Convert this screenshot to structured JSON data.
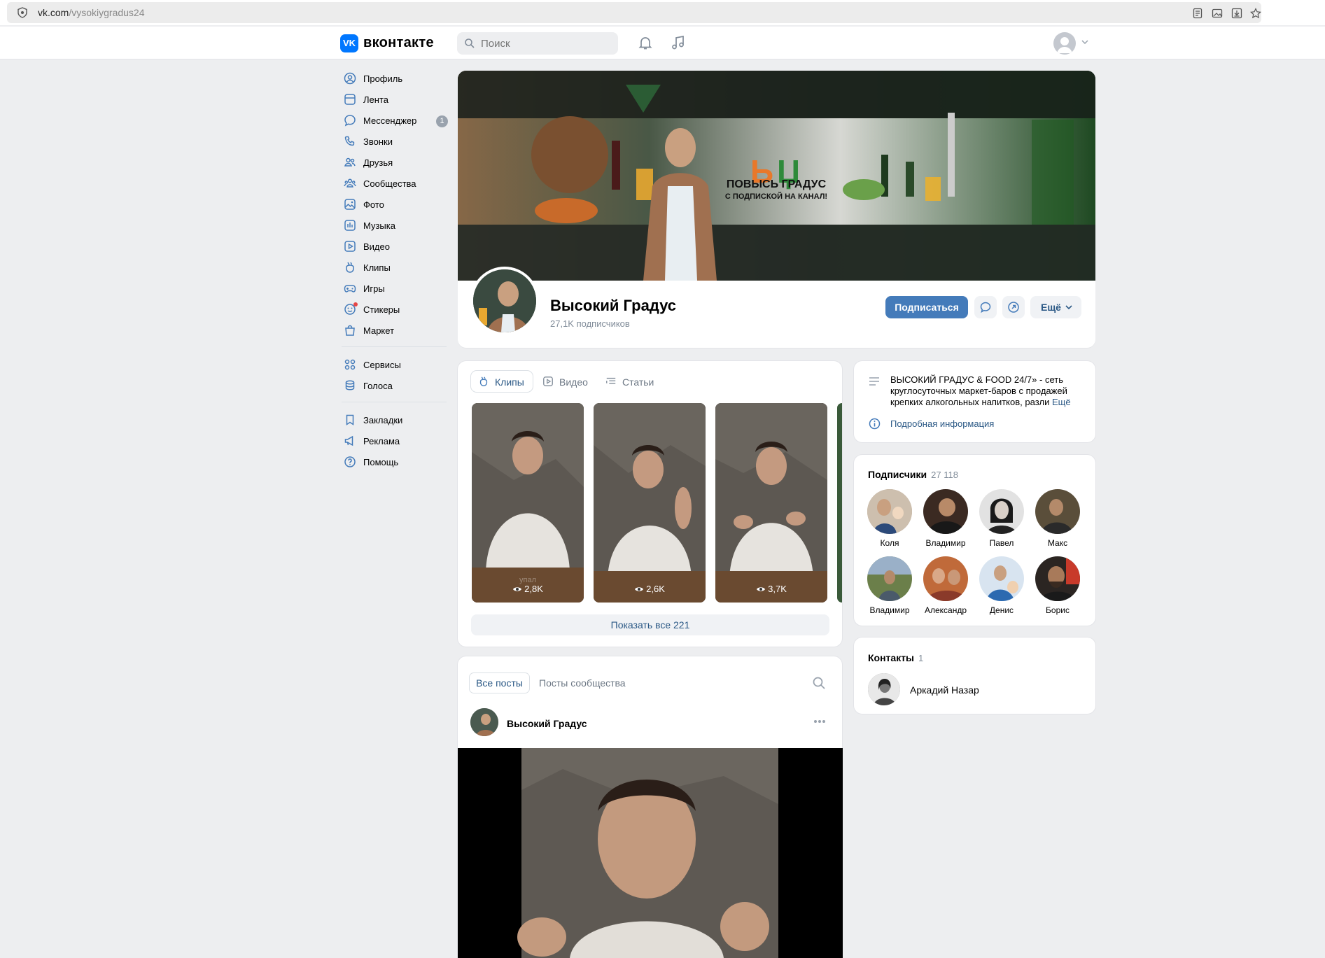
{
  "browser": {
    "url_domain": "vk.com",
    "url_path": "/vysokiygradus24"
  },
  "header": {
    "logo_text": "вконтакте",
    "logo_mark": "VK",
    "search_placeholder": "Поиск"
  },
  "sidebar": {
    "items": [
      {
        "label": "Профиль",
        "icon": "profile-icon"
      },
      {
        "label": "Лента",
        "icon": "feed-icon"
      },
      {
        "label": "Мессенджер",
        "icon": "messenger-icon",
        "badge": "1"
      },
      {
        "label": "Звонки",
        "icon": "phone-icon"
      },
      {
        "label": "Друзья",
        "icon": "friends-icon"
      },
      {
        "label": "Сообщества",
        "icon": "communities-icon"
      },
      {
        "label": "Фото",
        "icon": "photo-icon"
      },
      {
        "label": "Музыка",
        "icon": "music-icon"
      },
      {
        "label": "Видео",
        "icon": "video-icon"
      },
      {
        "label": "Клипы",
        "icon": "clips-icon"
      },
      {
        "label": "Игры",
        "icon": "games-icon"
      },
      {
        "label": "Стикеры",
        "icon": "stickers-icon"
      },
      {
        "label": "Маркет",
        "icon": "market-icon"
      }
    ],
    "items2": [
      {
        "label": "Сервисы",
        "icon": "services-icon"
      },
      {
        "label": "Голоса",
        "icon": "votes-icon"
      }
    ],
    "items3": [
      {
        "label": "Закладки",
        "icon": "bookmark-icon"
      },
      {
        "label": "Реклама",
        "icon": "ads-icon"
      },
      {
        "label": "Помощь",
        "icon": "help-icon"
      }
    ]
  },
  "cover": {
    "banner_line1": "ПОВЫСЬ ГРАДУС",
    "banner_line2": "С ПОДПИСКОЙ НА КАНАЛ!"
  },
  "profile": {
    "name": "Высокий Градус",
    "subscribers": "27,1K подписчиков",
    "subscribe_label": "Подписаться",
    "more_label": "Ещё"
  },
  "media_tabs": [
    {
      "label": "Клипы",
      "active": true
    },
    {
      "label": "Видео",
      "active": false
    },
    {
      "label": "Статьи",
      "active": false
    }
  ],
  "clips": [
    {
      "views": "2,8K"
    },
    {
      "views": "2,6K"
    },
    {
      "views": "3,7K"
    }
  ],
  "clips_show_all": "Показать все 221",
  "posts": {
    "tab_all": "Все посты",
    "tab_community": "Посты сообщества",
    "author": "Высокий Градус"
  },
  "about": {
    "description": "ВЫСОКИЙ ГРАДУС & FOOD 24/7» - сеть круглосуточных маркет-баров с продажей крепких алкогольных напитков, разли",
    "more": "Ещё",
    "info_link": "Подробная информация"
  },
  "followers": {
    "title": "Подписчики",
    "count": "27 118",
    "items": [
      {
        "name": "Коля",
        "color": "#b9a58f"
      },
      {
        "name": "Владимир",
        "color": "#3b2a22"
      },
      {
        "name": "Павел",
        "color": "#d8d8d8"
      },
      {
        "name": "Макс",
        "color": "#5a4e3a"
      },
      {
        "name": "Владимир",
        "color": "#6b7f4a"
      },
      {
        "name": "Александр",
        "color": "#c06a3a"
      },
      {
        "name": "Денис",
        "color": "#7a9ac8"
      },
      {
        "name": "Борис",
        "color": "#2b2522"
      }
    ]
  },
  "contacts": {
    "title": "Контакты",
    "count": "1",
    "name": "Аркадий Назар"
  }
}
